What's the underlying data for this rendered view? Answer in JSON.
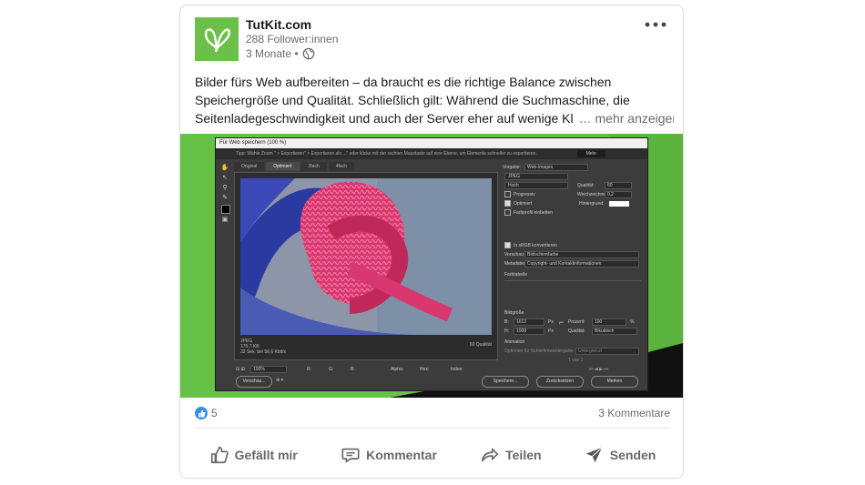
{
  "post": {
    "author": "TutKit.com",
    "followers": "288 Follower:innen",
    "time": "3 Monate •",
    "text_lines": [
      "Bilder fürs Web aufbereiten – da braucht es die richtige Balance zwischen",
      "Speichergröße und Qualität. Schließlich gilt: Während die Suchmaschine, die",
      "Seitenladegeschwindigkeit und auch der Server eher auf wenige Kl"
    ],
    "see_more": "… mehr anzeigen"
  },
  "screenshot": {
    "title": "Für Web speichern (100 %)",
    "tip": "Tipp: Wähle Zoom \" > Exportieren\" > Exportieren als ...\" oder klicke mit der rechten Maustaste auf eine Ebene, um Elemente schneller zu exportieren.",
    "mehr": "Mehr",
    "tabs": [
      "Original",
      "Optimiert",
      "2fach",
      "4fach"
    ],
    "info_lines": [
      "JPEG",
      "175,7 KB",
      "32 Sek. bei 56,6 Kbit/s"
    ],
    "quality_readout": "60 Qualität",
    "panel": {
      "preset_label": "Vorgabe:",
      "preset_value": "Web-Images",
      "format": "JPEG",
      "compression": "Hoch",
      "quality_label": "Qualität:",
      "quality_value": "60",
      "progressive": "Progressiv",
      "blur_label": "Weichzeichnen:",
      "blur_value": "0,2",
      "optimized": "Optimiert",
      "matte_label": "Hintergrund:",
      "embed_profile": "Farbprofil einbetten",
      "convert_srgb": "In sRGB konvertieren",
      "preview_label": "Vorschau:",
      "preview_value": "Bildschirmfarbe",
      "metadata_label": "Metadaten:",
      "metadata_value": "Copyright- und Kontaktinformationen",
      "color_table": "Farbtabelle",
      "image_size": "Bildgröße",
      "w_label": "B:",
      "w_value": "1612",
      "h_label": "H:",
      "h_value": "1008",
      "px": "Px",
      "percent_label": "Prozent:",
      "percent_value": "100",
      "percent_unit": "%",
      "quality2_label": "Qualität:",
      "quality2_value": "Bikubisch",
      "animation": "Animation",
      "loop_label": "Optionen für Schleifenwiedergabe:",
      "loop_value": "Unbegrenzt",
      "frames": "1 von 1"
    },
    "zoom": "100%",
    "bottom_labels": [
      "R:",
      "G:",
      "B:",
      "Alpha:",
      "Hex:",
      "Index:"
    ],
    "buttons": {
      "preview": "Vorschau...",
      "save": "Speichern...",
      "reset": "Zurücksetzen",
      "remember": "Merken"
    }
  },
  "social": {
    "reactions_count": "5",
    "comments": "3 Kommentare"
  },
  "actions": {
    "like": "Gefällt mir",
    "comment": "Kommentar",
    "share": "Teilen",
    "send": "Senden"
  },
  "colors": {
    "brand_green": "#6cc04a",
    "like_blue": "#378fe9"
  }
}
